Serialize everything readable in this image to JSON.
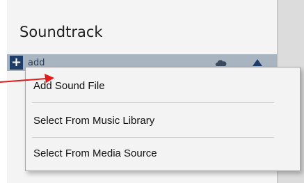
{
  "panel": {
    "title": "Soundtrack"
  },
  "toolbar": {
    "add_icon": "plus-icon",
    "add_label": "add",
    "cloud_icon": "cloud-icon",
    "up_icon": "chevron-up-icon"
  },
  "menu": {
    "items": [
      {
        "label": "Add Sound File"
      },
      {
        "label": "Select From Music Library"
      },
      {
        "label": "Select From Media Source"
      }
    ]
  },
  "colors": {
    "toolbar_bg": "#a8b4c0",
    "add_button_bg": "#1e3c68",
    "pointer": "#e11a1a"
  }
}
